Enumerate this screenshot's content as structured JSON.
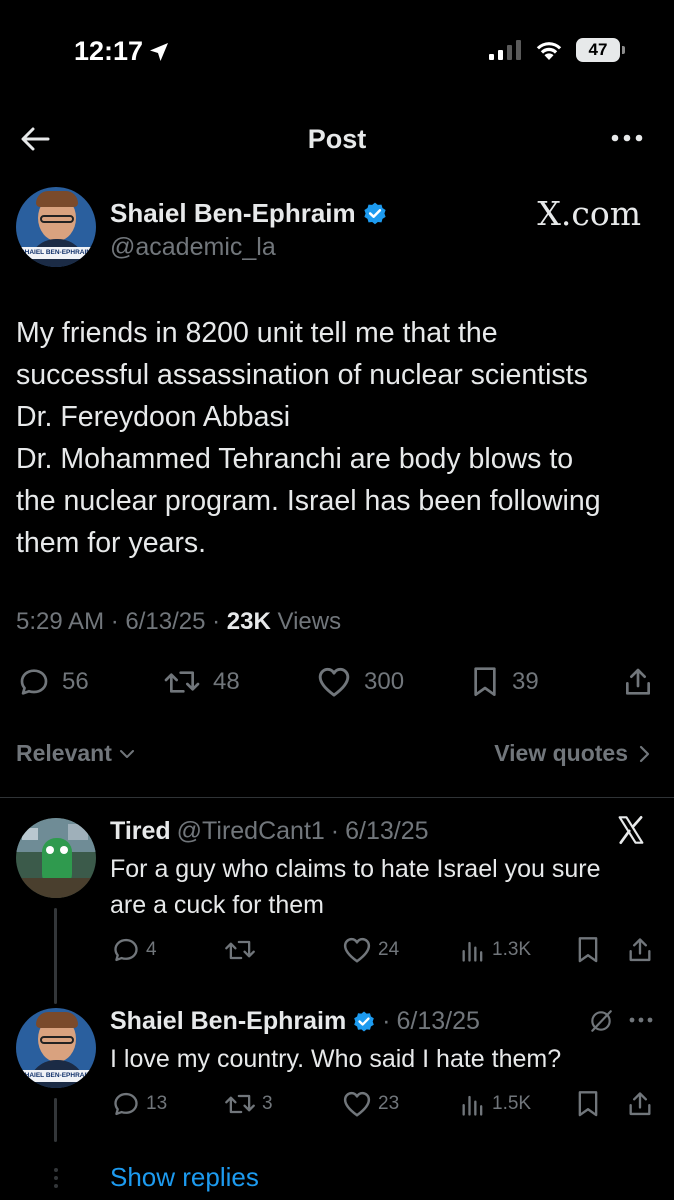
{
  "status_bar": {
    "time": "12:17",
    "battery": "47"
  },
  "nav": {
    "title": "Post"
  },
  "post": {
    "author_name": "Shaiel Ben-Ephraim",
    "author_handle": "@academic_la",
    "avatar_caption": "SHAIEL BEN-EPHRAIM",
    "brand": "X.com",
    "text_lines": [
      "My friends in 8200 unit tell me that the",
      "successful assassination of nuclear scientists",
      "Dr. Fereydoon Abbasi",
      "Dr. Mohammed Tehranchi are body blows to",
      "the nuclear program. Israel has been following",
      "them for years."
    ],
    "time": "5:29 AM",
    "date": "6/13/25",
    "views_count": "23K",
    "views_label": "Views",
    "replies": "56",
    "reposts": "48",
    "likes": "300",
    "bookmarks": "39"
  },
  "sort": {
    "label": "Relevant",
    "view_quotes": "View quotes"
  },
  "replies": [
    {
      "name": "Tired",
      "handle": "@TiredCant1",
      "date": "6/13/25",
      "text_lines": [
        "For a guy who claims to hate Israel you sure",
        "are a cuck for them"
      ],
      "replies": "4",
      "reposts": "",
      "likes": "24",
      "views": "1.3K"
    },
    {
      "name": "Shaiel Ben-Ephraim",
      "handle": "",
      "date": "6/13/25",
      "avatar_caption": "SHAIEL BEN-EPHRAIM",
      "text_lines": [
        "I love my country. Who said I hate them?"
      ],
      "replies": "13",
      "reposts": "3",
      "likes": "23",
      "views": "1.5K"
    }
  ],
  "show_replies": "Show replies",
  "colors": {
    "accent": "#1d9bf0",
    "text": "#e7e9ea",
    "muted": "#71767b",
    "background": "#000000"
  }
}
